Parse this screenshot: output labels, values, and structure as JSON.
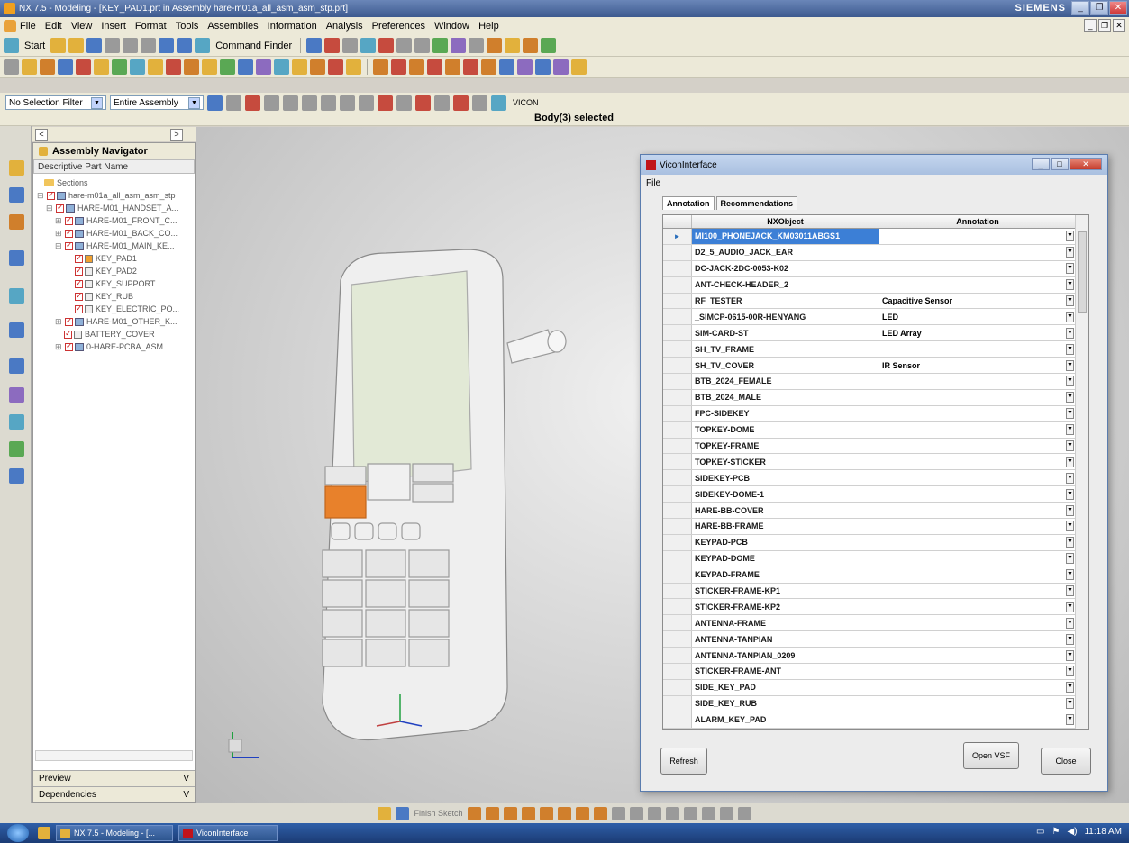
{
  "window": {
    "title": "NX 7.5 - Modeling - [KEY_PAD1.prt in Assembly hare-m01a_all_asm_asm_stp.prt]",
    "brand": "SIEMENS"
  },
  "menu": [
    "File",
    "Edit",
    "View",
    "Insert",
    "Format",
    "Tools",
    "Assemblies",
    "Information",
    "Analysis",
    "Preferences",
    "Window",
    "Help"
  ],
  "toolbar": {
    "start_label": "Start",
    "command_finder_label": "Command Finder"
  },
  "filters": {
    "selection_filter": "No Selection Filter",
    "scope": "Entire Assembly",
    "vicon_label": "VICON"
  },
  "status": {
    "selection": "Body(3) selected"
  },
  "navigator": {
    "title": "Assembly Navigator",
    "column": "Descriptive Part Name",
    "items": [
      {
        "label": "Sections",
        "type": "folder"
      },
      {
        "label": "hare-m01a_all_asm_asm_stp",
        "type": "asm"
      },
      {
        "label": "HARE-M01_HANDSET_A...",
        "type": "asm"
      },
      {
        "label": "HARE-M01_FRONT_C...",
        "type": "asm"
      },
      {
        "label": "HARE-M01_BACK_CO...",
        "type": "asm"
      },
      {
        "label": "HARE-M01_MAIN_KE...",
        "type": "asm"
      },
      {
        "label": "KEY_PAD1",
        "type": "prt"
      },
      {
        "label": "KEY_PAD2",
        "type": "prt"
      },
      {
        "label": "KEY_SUPPORT",
        "type": "prt"
      },
      {
        "label": "KEY_RUB",
        "type": "prt"
      },
      {
        "label": "KEY_ELECTRIC_PO...",
        "type": "prt"
      },
      {
        "label": "HARE-M01_OTHER_K...",
        "type": "asm"
      },
      {
        "label": "BATTERY_COVER",
        "type": "prt"
      },
      {
        "label": "0-HARE-PCBA_ASM",
        "type": "asm"
      }
    ],
    "preview_label": "Preview",
    "dependencies_label": "Dependencies"
  },
  "dialog": {
    "title": "ViconInterface",
    "menu_file": "File",
    "tabs": [
      "Annotation",
      "Recommendations"
    ],
    "col_nxobject": "NXObject",
    "col_annotation": "Annotation",
    "rows": [
      {
        "nx": "MI100_PHONEJACK_KM03011ABGS1",
        "annotation": ""
      },
      {
        "nx": "D2_5_AUDIO_JACK_EAR",
        "annotation": ""
      },
      {
        "nx": "DC-JACK-2DC-0053-K02",
        "annotation": ""
      },
      {
        "nx": "ANT-CHECK-HEADER_2",
        "annotation": ""
      },
      {
        "nx": "RF_TESTER",
        "annotation": "Capacitive Sensor"
      },
      {
        "nx": "_SIMCP-0615-00R-HENYANG",
        "annotation": "LED"
      },
      {
        "nx": "SIM-CARD-ST",
        "annotation": "LED Array"
      },
      {
        "nx": "SH_TV_FRAME",
        "annotation": ""
      },
      {
        "nx": "SH_TV_COVER",
        "annotation": "IR Sensor"
      },
      {
        "nx": "BTB_2024_FEMALE",
        "annotation": ""
      },
      {
        "nx": "BTB_2024_MALE",
        "annotation": ""
      },
      {
        "nx": "FPC-SIDEKEY",
        "annotation": ""
      },
      {
        "nx": "TOPKEY-DOME",
        "annotation": ""
      },
      {
        "nx": "TOPKEY-FRAME",
        "annotation": ""
      },
      {
        "nx": "TOPKEY-STICKER",
        "annotation": ""
      },
      {
        "nx": "SIDEKEY-PCB",
        "annotation": ""
      },
      {
        "nx": "SIDEKEY-DOME-1",
        "annotation": ""
      },
      {
        "nx": "HARE-BB-COVER",
        "annotation": ""
      },
      {
        "nx": "HARE-BB-FRAME",
        "annotation": ""
      },
      {
        "nx": "KEYPAD-PCB",
        "annotation": ""
      },
      {
        "nx": "KEYPAD-DOME",
        "annotation": ""
      },
      {
        "nx": "KEYPAD-FRAME",
        "annotation": ""
      },
      {
        "nx": "STICKER-FRAME-KP1",
        "annotation": ""
      },
      {
        "nx": "STICKER-FRAME-KP2",
        "annotation": ""
      },
      {
        "nx": "ANTENNA-FRAME",
        "annotation": ""
      },
      {
        "nx": "ANTENNA-TANPIAN",
        "annotation": ""
      },
      {
        "nx": "ANTENNA-TANPIAN_0209",
        "annotation": ""
      },
      {
        "nx": "STICKER-FRAME-ANT",
        "annotation": ""
      },
      {
        "nx": "SIDE_KEY_PAD",
        "annotation": ""
      },
      {
        "nx": "SIDE_KEY_RUB",
        "annotation": ""
      },
      {
        "nx": "ALARM_KEY_PAD",
        "annotation": ""
      }
    ],
    "refresh_label": "Refresh",
    "open_vsf_label": "Open VSF",
    "close_label": "Close"
  },
  "sketch": {
    "finish_label": "Finish Sketch"
  },
  "taskbar": {
    "task1": "NX 7.5 - Modeling - [...",
    "task2": "ViconInterface",
    "clock": "11:18 AM"
  }
}
